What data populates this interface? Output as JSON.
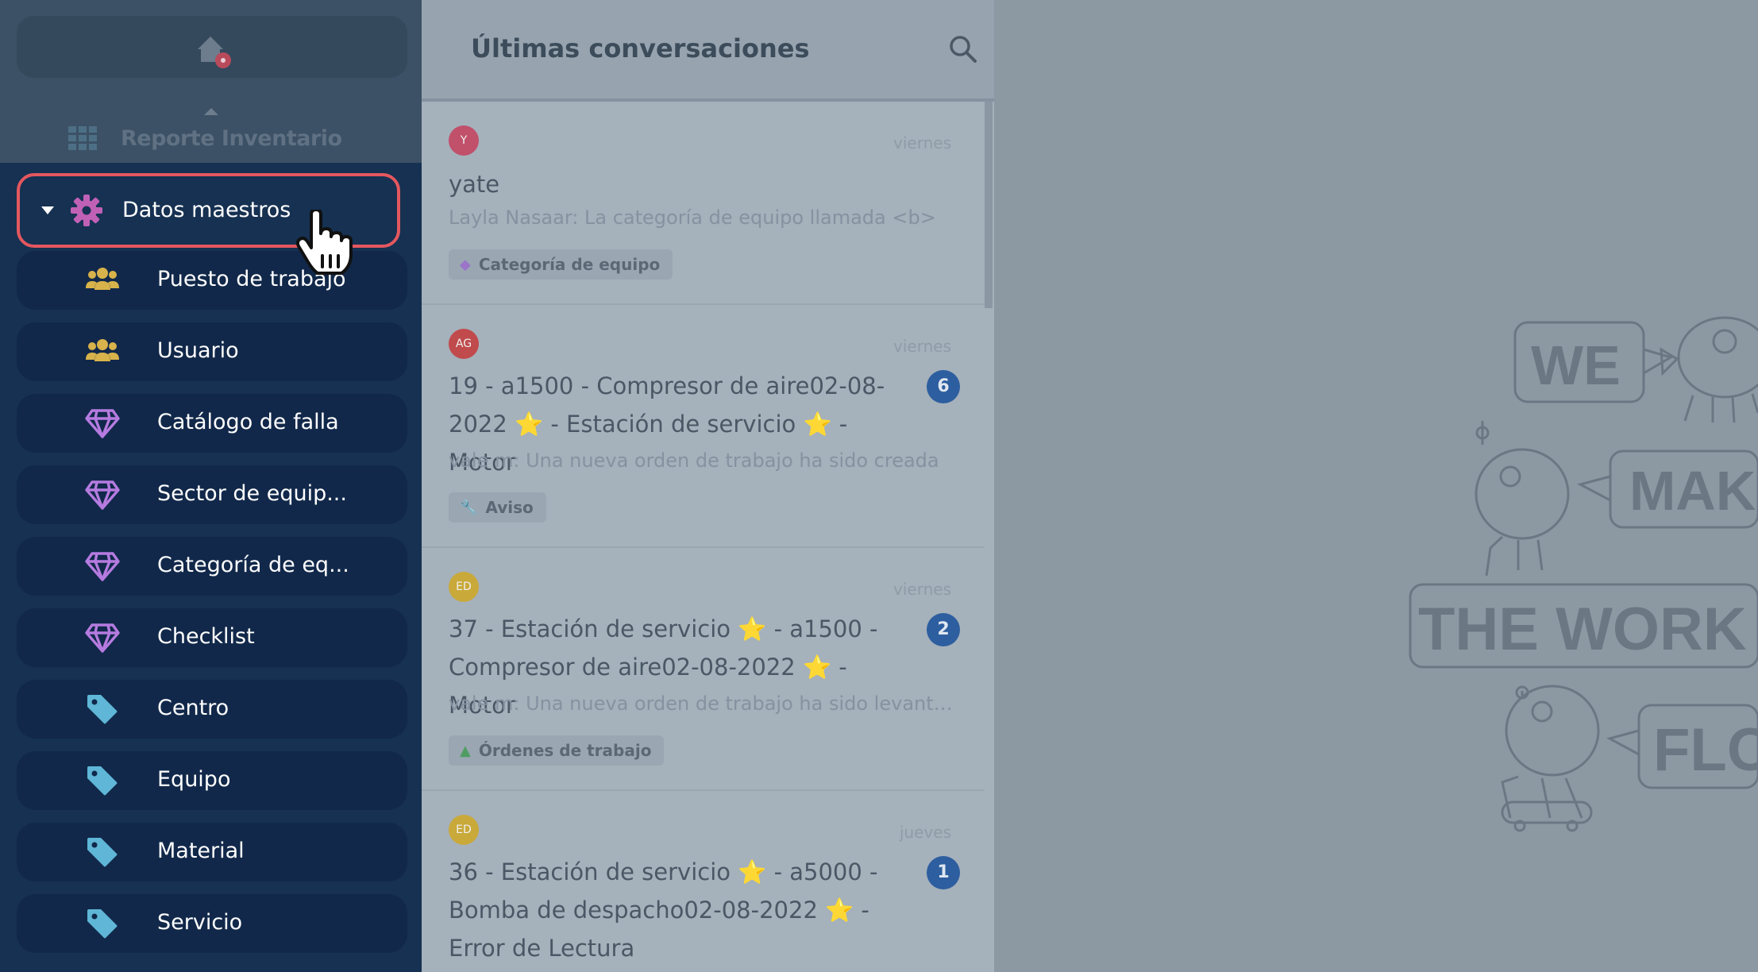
{
  "sidebar": {
    "top_item": {
      "label": "Reporte Inventario"
    },
    "parent": {
      "label": "Datos maestros"
    },
    "items": [
      {
        "label": "Puesto de trabajo",
        "icon": "users-icon"
      },
      {
        "label": "Usuario",
        "icon": "users-icon"
      },
      {
        "label": "Catálogo de falla",
        "icon": "diamond-icon"
      },
      {
        "label": "Sector de equip...",
        "icon": "diamond-icon"
      },
      {
        "label": "Categoría de eq...",
        "icon": "diamond-icon"
      },
      {
        "label": "Checklist",
        "icon": "diamond-icon"
      },
      {
        "label": "Centro",
        "icon": "tag-icon"
      },
      {
        "label": "Equipo",
        "icon": "tag-icon"
      },
      {
        "label": "Material",
        "icon": "tag-icon"
      },
      {
        "label": "Servicio",
        "icon": "tag-icon"
      }
    ]
  },
  "conversations": {
    "title": "Últimas conversaciones",
    "items": [
      {
        "avatar": "Y",
        "avatar_color": "#c1506b",
        "day": "viernes",
        "name": "yate",
        "preview": "Layla Nasaar: La categoría de equipo llamada <b>",
        "tag": "Categoría de equipo",
        "tag_glyph": "◆"
      },
      {
        "avatar": "AG",
        "avatar_color": "#c04a4c",
        "day": "viernes",
        "badge": "6",
        "name": "19 - a1500 - Compresor de aire02-08-2022 ⭐ - Estación de servicio ⭐ - Motor",
        "preview": "vale m: Una nueva orden de trabajo ha sido creada",
        "tag": "Aviso",
        "tag_glyph": "🔧"
      },
      {
        "avatar": "ED",
        "avatar_color": "#c9a93a",
        "day": "viernes",
        "badge": "2",
        "name": "37 - Estación de servicio ⭐ - a1500 - Compresor de aire02-08-2022 ⭐ - Motor",
        "preview": "vale m: Una nueva orden de trabajo ha sido levantada",
        "tag": "Órdenes de trabajo",
        "tag_glyph": "▲"
      },
      {
        "avatar": "ED",
        "avatar_color": "#c9a93a",
        "day": "jueves",
        "badge": "1",
        "name": "36 - Estación de servicio ⭐ - a5000 - Bomba de despacho02-08-2022 ⭐ - Error de Lectura"
      }
    ]
  },
  "illustration": {
    "words": [
      "WE",
      "MAK",
      "THE WORK",
      "FLO"
    ]
  },
  "colors": {
    "highlight_border": "#e4575f",
    "sidebar_bg": "#163152",
    "users_icon": "#d8b24a",
    "diamond_icon": "#b57be0",
    "tag_icon": "#5fb6d6",
    "gear_icon": "#c061b6"
  }
}
